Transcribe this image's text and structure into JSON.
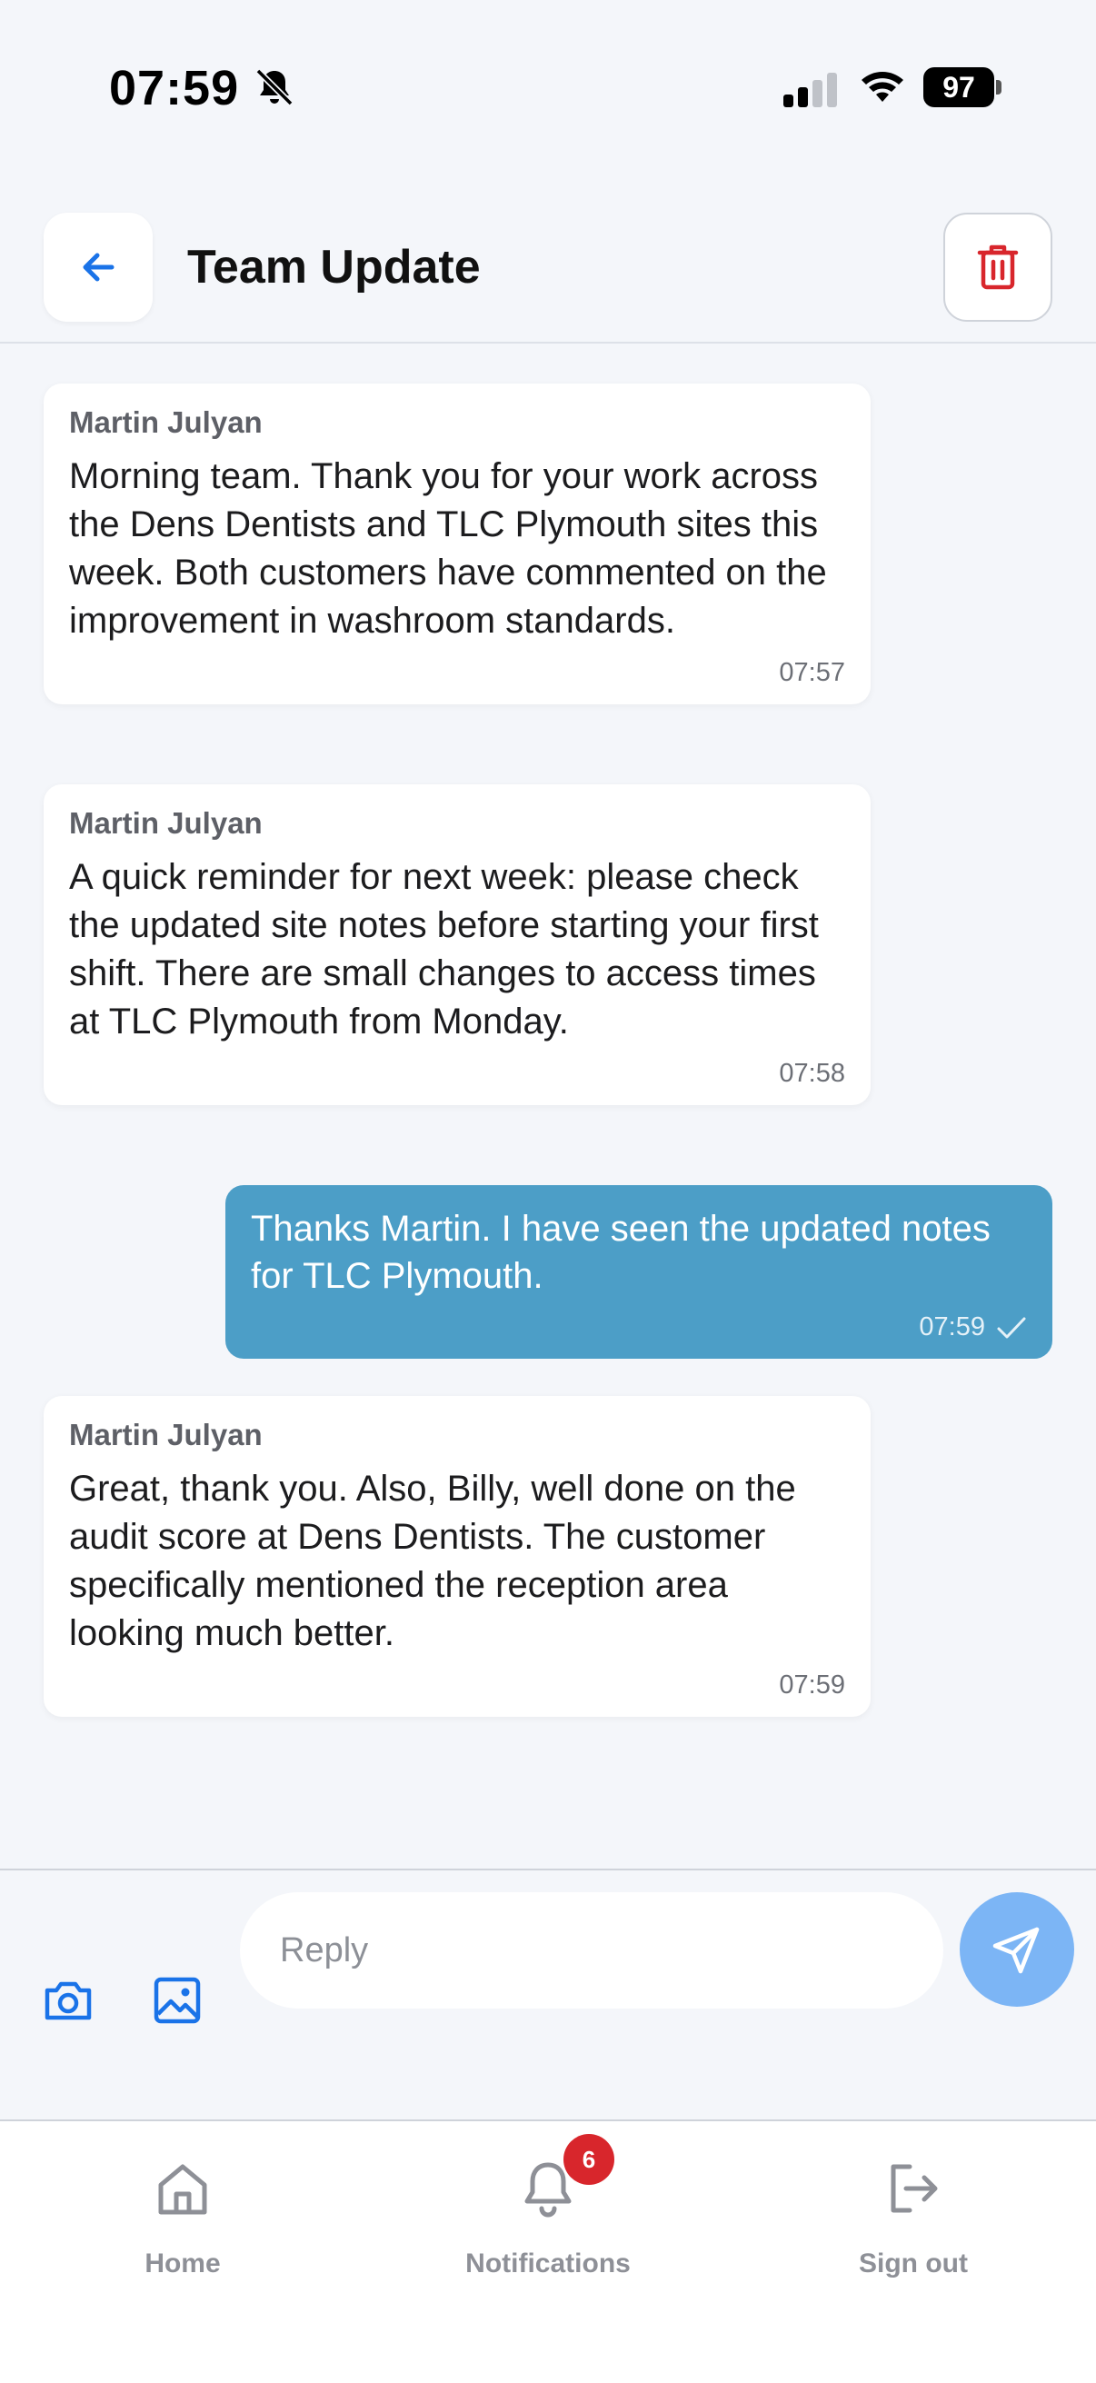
{
  "status_bar": {
    "time": "07:59",
    "battery": "97"
  },
  "header": {
    "title": "Team Update"
  },
  "messages": [
    {
      "sender": "Martin Julyan",
      "text": "Morning team. Thank you for your work across the Dens Dentists and TLC Plymouth sites this week. Both customers have commented on the improvement in washroom standards.",
      "time": "07:57",
      "outgoing": false
    },
    {
      "sender": "Martin Julyan",
      "text": "A quick reminder for next week: please check the updated site notes before starting your first shift. There are small changes to access times at TLC Plymouth from Monday.",
      "time": "07:58",
      "outgoing": false
    },
    {
      "text": "Thanks Martin. I have seen the updated notes for TLC Plymouth.",
      "time": "07:59",
      "outgoing": true
    },
    {
      "sender": "Martin Julyan",
      "text": "Great, thank you. Also, Billy, well done on the audit score at Dens Dentists. The customer specifically mentioned the reception area looking much better.",
      "time": "07:59",
      "outgoing": false
    }
  ],
  "composer": {
    "placeholder": "Reply",
    "value": ""
  },
  "tabbar": {
    "home": "Home",
    "notifications": "Notifications",
    "notifications_badge": "6",
    "signout": "Sign out"
  },
  "colors": {
    "accent": "#1a73e8",
    "outgoing_bubble": "#4c9ec7",
    "send_button": "#7cb5f5",
    "delete": "#d8262c",
    "badge": "#d8262c"
  },
  "icons": [
    "bell-slash-icon",
    "signal-icon",
    "wifi-icon",
    "battery-icon",
    "arrow-left-icon",
    "trash-icon",
    "check-icon",
    "camera-icon",
    "image-icon",
    "send-icon",
    "home-icon",
    "bell-icon",
    "sign-out-icon"
  ]
}
